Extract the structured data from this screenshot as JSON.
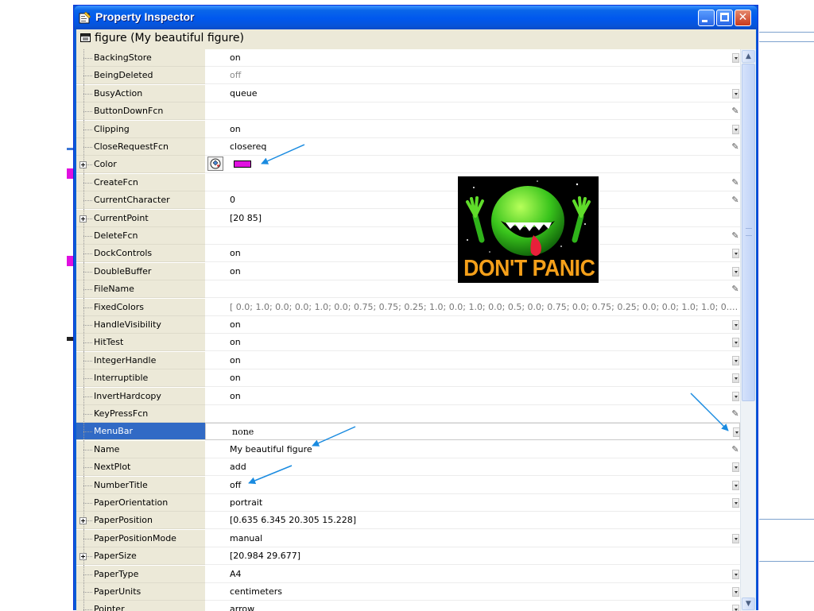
{
  "window": {
    "title": "Property Inspector",
    "object_label": "figure (My beautiful figure)"
  },
  "colors": {
    "title_bar": "#0058ee",
    "selection": "#316ac5",
    "swatch": "#e010e0",
    "annotation_arrow": "#1a8be0",
    "poster_text": "#f5a01a"
  },
  "poster": {
    "text": "DON'T PANIC"
  },
  "properties": [
    {
      "name": "BackingStore",
      "value": "on",
      "control": "dropdown"
    },
    {
      "name": "BeingDeleted",
      "value": "off",
      "control": "none",
      "dim": true
    },
    {
      "name": "BusyAction",
      "value": "queue",
      "control": "dropdown"
    },
    {
      "name": "ButtonDownFcn",
      "value": "",
      "control": "edit"
    },
    {
      "name": "Clipping",
      "value": "on",
      "control": "dropdown"
    },
    {
      "name": "CloseRequestFcn",
      "value": "closereq",
      "control": "edit"
    },
    {
      "name": "Color",
      "value": "",
      "control": "color",
      "expandable": true
    },
    {
      "name": "CreateFcn",
      "value": "",
      "control": "edit"
    },
    {
      "name": "CurrentCharacter",
      "value": "0",
      "control": "edit"
    },
    {
      "name": "CurrentPoint",
      "value": "[20 85]",
      "control": "none",
      "expandable": true
    },
    {
      "name": "DeleteFcn",
      "value": "",
      "control": "edit"
    },
    {
      "name": "DockControls",
      "value": "on",
      "control": "dropdown"
    },
    {
      "name": "DoubleBuffer",
      "value": "on",
      "control": "dropdown"
    },
    {
      "name": "FileName",
      "value": "",
      "control": "edit"
    },
    {
      "name": "FixedColors",
      "value": "[ 0.0; 1.0; 0.0; 0.0; 1.0; 0.0; 0.75; 0.75; 0.25; 1.0; 0.0; 1.0; 0.0; 0.5; 0.0; 0.75; 0.0; 0.75; 0.25; 0.0; 0.0; 1.0; 1.0; 0.0...",
      "control": "none",
      "long": true
    },
    {
      "name": "HandleVisibility",
      "value": "on",
      "control": "dropdown"
    },
    {
      "name": "HitTest",
      "value": "on",
      "control": "dropdown"
    },
    {
      "name": "IntegerHandle",
      "value": "on",
      "control": "dropdown"
    },
    {
      "name": "Interruptible",
      "value": "on",
      "control": "dropdown"
    },
    {
      "name": "InvertHardcopy",
      "value": "on",
      "control": "dropdown"
    },
    {
      "name": "KeyPressFcn",
      "value": "",
      "control": "edit"
    },
    {
      "name": "MenuBar",
      "value": "none",
      "control": "dropdown",
      "selected": true
    },
    {
      "name": "Name",
      "value": "My beautiful figure",
      "control": "edit"
    },
    {
      "name": "NextPlot",
      "value": "add",
      "control": "dropdown"
    },
    {
      "name": "NumberTitle",
      "value": "off",
      "control": "dropdown"
    },
    {
      "name": "PaperOrientation",
      "value": "portrait",
      "control": "dropdown"
    },
    {
      "name": "PaperPosition",
      "value": "[0.635 6.345 20.305 15.228]",
      "control": "none",
      "expandable": true
    },
    {
      "name": "PaperPositionMode",
      "value": "manual",
      "control": "dropdown"
    },
    {
      "name": "PaperSize",
      "value": "[20.984 29.677]",
      "control": "none",
      "expandable": true
    },
    {
      "name": "PaperType",
      "value": "A4",
      "control": "dropdown"
    },
    {
      "name": "PaperUnits",
      "value": "centimeters",
      "control": "dropdown"
    },
    {
      "name": "Pointer",
      "value": "arrow",
      "control": "dropdown"
    }
  ]
}
